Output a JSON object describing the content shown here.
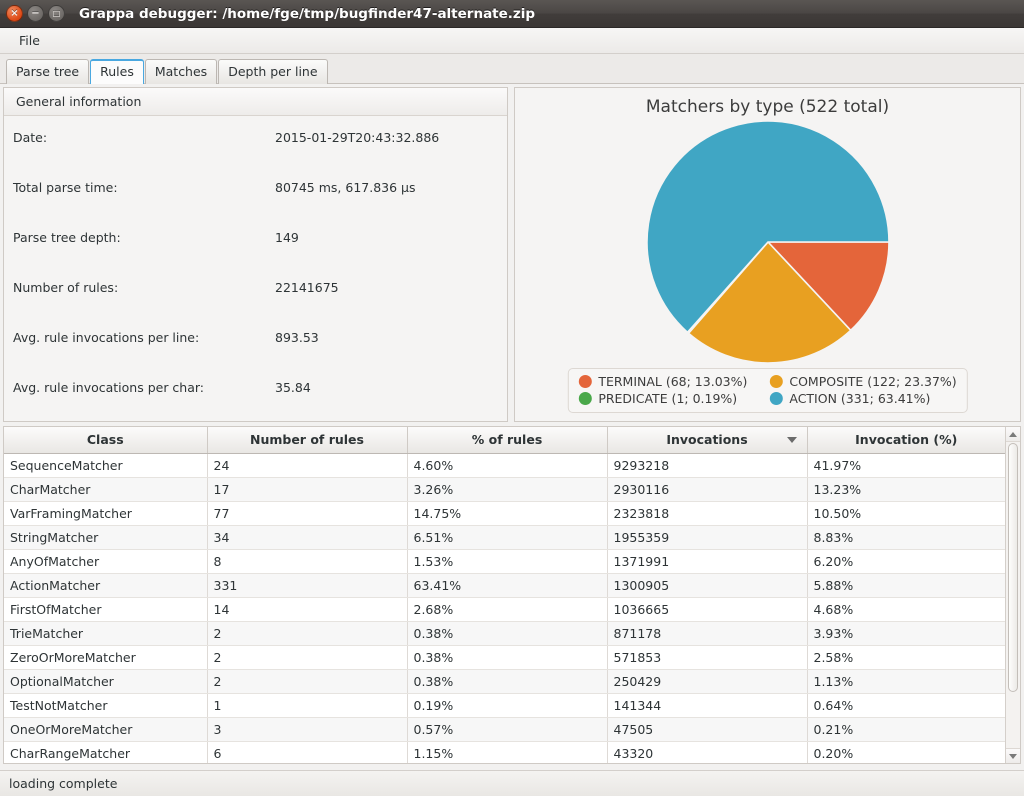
{
  "window": {
    "title": "Grappa debugger: /home/fge/tmp/bugfinder47-alternate.zip",
    "close_glyph": "×",
    "minimize_glyph": "−",
    "maximize_glyph": "□"
  },
  "menu": {
    "items": [
      {
        "label": "File"
      }
    ]
  },
  "tabs": [
    {
      "label": "Parse tree",
      "active": false
    },
    {
      "label": "Rules",
      "active": true
    },
    {
      "label": "Matches",
      "active": false
    },
    {
      "label": "Depth per line",
      "active": false
    }
  ],
  "general_information": {
    "header": "General information",
    "rows": [
      {
        "label": "Date:",
        "value": "2015-01-29T20:43:32.886"
      },
      {
        "label": "Total parse time:",
        "value": "80745 ms, 617.836 µs"
      },
      {
        "label": "Parse tree depth:",
        "value": "149"
      },
      {
        "label": "Number of rules:",
        "value": "22141675"
      },
      {
        "label": "Avg. rule invocations per line:",
        "value": "893.53"
      },
      {
        "label": "Avg. rule invocations per char:",
        "value": "35.84"
      }
    ]
  },
  "chart_data": {
    "type": "pie",
    "title": "Matchers by type (522 total)",
    "total": 522,
    "start_angle_deg": 0,
    "direction": "clockwise",
    "legend_position": "bottom",
    "categories": [
      "TERMINAL",
      "COMPOSITE",
      "PREDICATE",
      "ACTION"
    ],
    "values": [
      68,
      122,
      1,
      331
    ],
    "percentages": [
      13.03,
      23.37,
      0.19,
      63.41
    ],
    "colors": [
      "#e4653a",
      "#e8a021",
      "#4aa84a",
      "#40a6c4"
    ],
    "legend_labels": [
      "TERMINAL (68; 13.03%)",
      "COMPOSITE (122; 23.37%)",
      "PREDICATE (1; 0.19%)",
      "ACTION (331; 63.41%)"
    ],
    "legend_order": [
      "TERMINAL (68; 13.03%)",
      "COMPOSITE (122; 23.37%)",
      "PREDICATE (1; 0.19%)",
      "ACTION (331; 63.41%)"
    ]
  },
  "table": {
    "columns": [
      {
        "label": "Class",
        "sort": "none"
      },
      {
        "label": "Number of rules",
        "sort": "none"
      },
      {
        "label": "% of rules",
        "sort": "none"
      },
      {
        "label": "Invocations",
        "sort": "desc"
      },
      {
        "label": "Invocation (%)",
        "sort": "none"
      }
    ],
    "rows": [
      {
        "class": "SequenceMatcher",
        "rules": "24",
        "pct_rules": "4.60%",
        "invocations": "9293218",
        "pct_inv": "41.97%"
      },
      {
        "class": "CharMatcher",
        "rules": "17",
        "pct_rules": "3.26%",
        "invocations": "2930116",
        "pct_inv": "13.23%"
      },
      {
        "class": "VarFramingMatcher",
        "rules": "77",
        "pct_rules": "14.75%",
        "invocations": "2323818",
        "pct_inv": "10.50%"
      },
      {
        "class": "StringMatcher",
        "rules": "34",
        "pct_rules": "6.51%",
        "invocations": "1955359",
        "pct_inv": "8.83%"
      },
      {
        "class": "AnyOfMatcher",
        "rules": "8",
        "pct_rules": "1.53%",
        "invocations": "1371991",
        "pct_inv": "6.20%"
      },
      {
        "class": "ActionMatcher",
        "rules": "331",
        "pct_rules": "63.41%",
        "invocations": "1300905",
        "pct_inv": "5.88%"
      },
      {
        "class": "FirstOfMatcher",
        "rules": "14",
        "pct_rules": "2.68%",
        "invocations": "1036665",
        "pct_inv": "4.68%"
      },
      {
        "class": "TrieMatcher",
        "rules": "2",
        "pct_rules": "0.38%",
        "invocations": "871178",
        "pct_inv": "3.93%"
      },
      {
        "class": "ZeroOrMoreMatcher",
        "rules": "2",
        "pct_rules": "0.38%",
        "invocations": "571853",
        "pct_inv": "2.58%"
      },
      {
        "class": "OptionalMatcher",
        "rules": "2",
        "pct_rules": "0.38%",
        "invocations": "250429",
        "pct_inv": "1.13%"
      },
      {
        "class": "TestNotMatcher",
        "rules": "1",
        "pct_rules": "0.19%",
        "invocations": "141344",
        "pct_inv": "0.64%"
      },
      {
        "class": "OneOrMoreMatcher",
        "rules": "3",
        "pct_rules": "0.57%",
        "invocations": "47505",
        "pct_inv": "0.21%"
      },
      {
        "class": "CharRangeMatcher",
        "rules": "6",
        "pct_rules": "1.15%",
        "invocations": "43320",
        "pct_inv": "0.20%"
      }
    ]
  },
  "statusbar": {
    "message": "loading complete"
  }
}
